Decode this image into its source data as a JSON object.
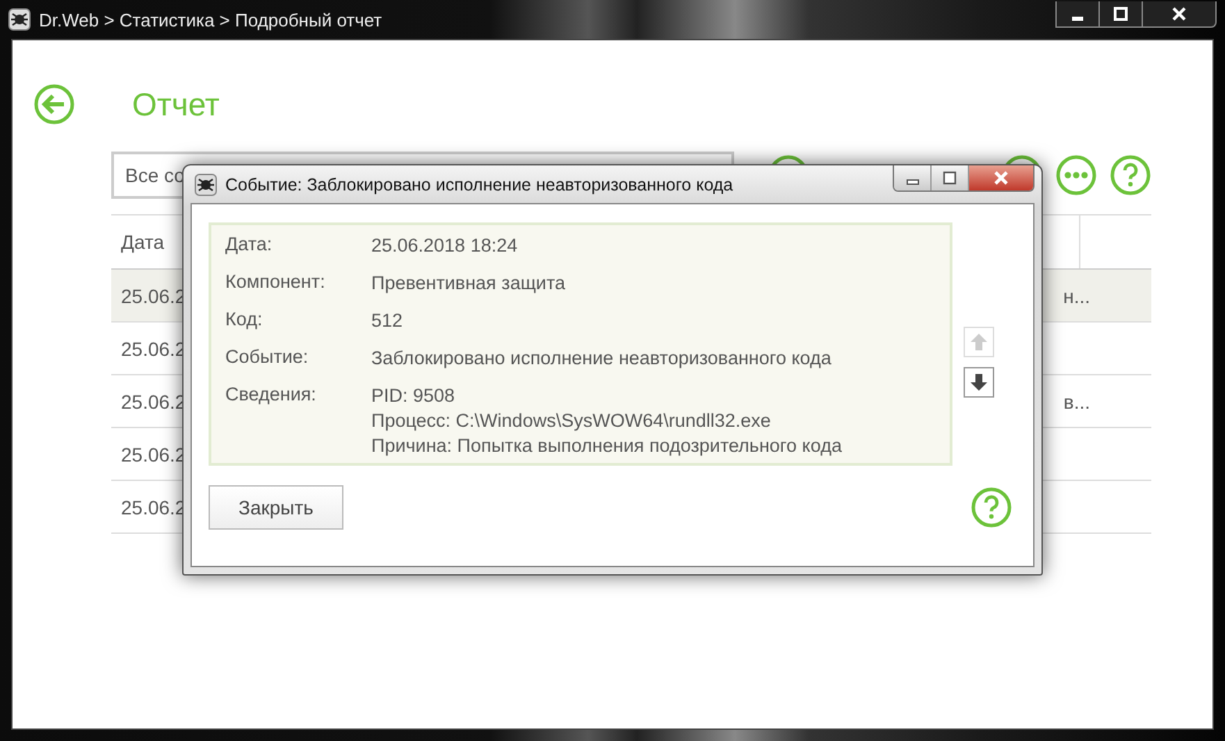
{
  "window": {
    "title": "Dr.Web > Статистика > Подробный отчет"
  },
  "page": {
    "title": "Отчет"
  },
  "filter": {
    "value": "Все со"
  },
  "table": {
    "columns": [
      "Дата"
    ],
    "rows": [
      {
        "date": "25.06.2",
        "column_2": "н...",
        "selected": true
      },
      {
        "date": "25.06.2",
        "column_2": "",
        "selected": false
      },
      {
        "date": "25.06.2",
        "column_2": "в...",
        "selected": false
      },
      {
        "date": "25.06.2",
        "column_2": "",
        "selected": false
      },
      {
        "date": "25.06.2",
        "column_2": "",
        "selected": false
      }
    ]
  },
  "dialog": {
    "title": "Событие: Заблокировано исполнение неавторизованного кода",
    "fields": [
      {
        "label": "Дата:",
        "lines": [
          "25.06.2018 18:24"
        ]
      },
      {
        "label": "Компонент:",
        "lines": [
          "Превентивная защита"
        ]
      },
      {
        "label": "Код:",
        "lines": [
          "512"
        ]
      },
      {
        "label": "Событие:",
        "lines": [
          "Заблокировано исполнение неавторизованного кода"
        ]
      },
      {
        "label": "Сведения:",
        "lines": [
          "PID: 9508",
          "Процесс: C:\\Windows\\SysWOW64\\rundll32.exe",
          "Причина: Попытка выполнения подозрительного кода"
        ]
      }
    ],
    "nav": [
      {
        "kind": "up",
        "disabled": true
      },
      {
        "kind": "down",
        "disabled": false
      }
    ],
    "button": "Закрыть"
  }
}
